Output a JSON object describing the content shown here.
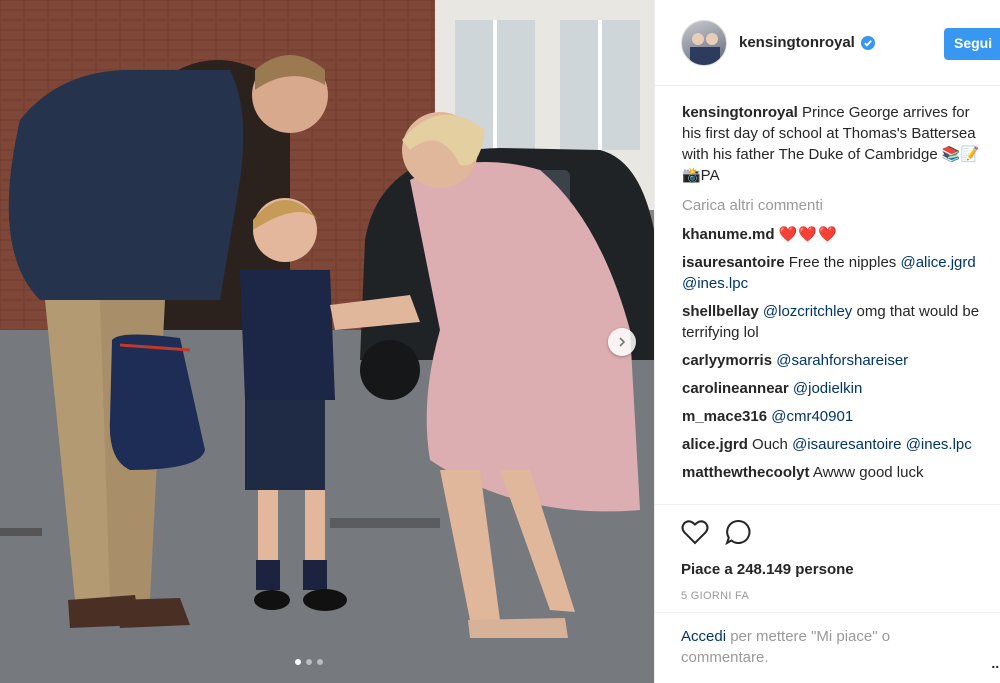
{
  "post": {
    "author": "kensingtonroyal",
    "follow_label": "Segui",
    "caption_text": "Prince George arrives for his first day of school at Thomas's Battersea with his father The Duke of Cambridge 📚📝📸PA",
    "load_more": "Carica altri commenti",
    "likes": "Piace a 248.149 persone",
    "time": "5 GIORNI FA",
    "login_link": "Accedi",
    "login_rest": " per mettere \"Mi piace\" o commentare.",
    "more": "..."
  },
  "comments": [
    {
      "user": "khanume.md",
      "mention": "",
      "text": "",
      "hearts": "❤️❤️❤️"
    },
    {
      "user": "isauresantoire",
      "text": "Free the nipples",
      "mentions": "@alice.jgrd @ines.lpc"
    },
    {
      "user": "shellbellay",
      "mention": "@lozcritchley",
      "text": "omg that would be terrifying lol"
    },
    {
      "user": "carlyymorris",
      "mention": "@sarahforshareiser",
      "text": ""
    },
    {
      "user": "carolineannear",
      "mention": "@jodielkin",
      "text": ""
    },
    {
      "user": "m_mace316",
      "mention": "@cmr40901",
      "text": ""
    },
    {
      "user": "alice.jgrd",
      "pre": "Ouch",
      "mention": "@isauresantoire",
      "mention2": "@ines.lpc"
    },
    {
      "user": "matthewthecoolyt",
      "text": "Awww good luck"
    }
  ],
  "icons": {
    "like": "heart-outline",
    "comment": "speech-bubble-outline",
    "next": "chevron-right",
    "verified": "blue-check-badge"
  },
  "colors": {
    "accent": "#3897f0",
    "link": "#003569",
    "muted": "#999999",
    "heart": "#e0245e"
  },
  "carousel": {
    "total": 3,
    "active": 1
  }
}
